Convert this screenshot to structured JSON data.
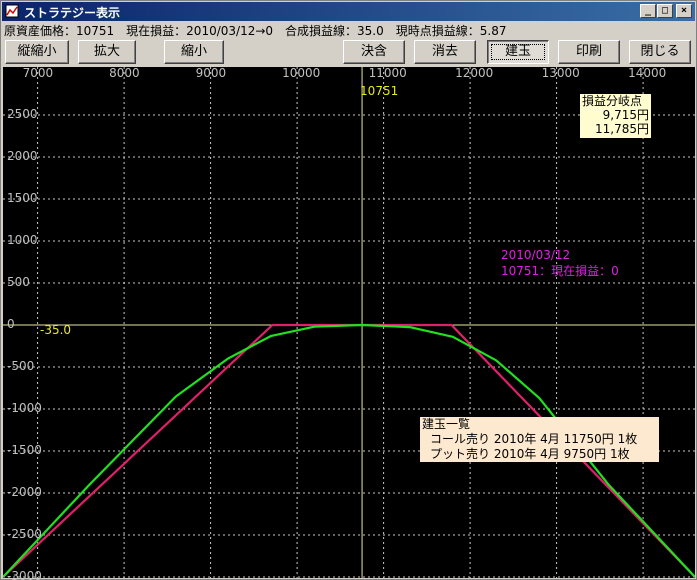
{
  "window": {
    "title": "ストラテジー表示",
    "min_symbol": "_",
    "max_symbol": "□",
    "close_symbol": "×"
  },
  "info_line": "原資産価格：10751　現在損益：2010/03/12→0　合成損益線：35.0　現時点損益線：5.87",
  "toolbar": {
    "zoom_vertical_out": "縦縮小",
    "zoom_in": "拡大",
    "zoom_out": "縮小",
    "settle": "決含",
    "clear": "消去",
    "position": "建玉",
    "print": "印刷",
    "close": "閉じる"
  },
  "chart_data": {
    "type": "line",
    "title": "",
    "xlabel": "",
    "ylabel": "",
    "xlim": [
      6600,
      14600
    ],
    "ylim": [
      -3000,
      3000
    ],
    "x_ticks": [
      "7000",
      "8000",
      "9000",
      "10000",
      "11000",
      "12000",
      "13000",
      "14000"
    ],
    "y_ticks": [
      "2500",
      "2000",
      "1500",
      "1000",
      "500",
      "0",
      "-500",
      "-1000",
      "-1500",
      "-2000",
      "-2500",
      "-3000"
    ],
    "current_price_marker": {
      "x": 10751,
      "label": "10751"
    },
    "zero_line_label": "-35.0",
    "series": [
      {
        "color": "#e0206a",
        "points": [
          [
            6600,
            -3000
          ],
          [
            9715,
            0
          ],
          [
            11785,
            0
          ],
          [
            14600,
            -3000
          ]
        ]
      },
      {
        "color": "#20e020",
        "points": [
          [
            6600,
            -3000
          ],
          [
            7600,
            -1900
          ],
          [
            8600,
            -850
          ],
          [
            9200,
            -400
          ],
          [
            9700,
            -130
          ],
          [
            10200,
            -20
          ],
          [
            10751,
            0
          ],
          [
            11300,
            -25
          ],
          [
            11800,
            -140
          ],
          [
            12300,
            -420
          ],
          [
            12800,
            -870
          ],
          [
            13600,
            -1900
          ],
          [
            14600,
            -3000
          ]
        ]
      }
    ],
    "annotations": {
      "breakeven_title": "損益分岐点",
      "breakeven_low": "9,715円",
      "breakeven_high": "11,785円",
      "current_date": "2010/03/12",
      "current_pl": "10751：現在損益：0",
      "positions_title": "建玉一覧",
      "position_1": "コール売り 2010年 4月 11750円 1枚",
      "position_2": "プット売り 2010年 4月 9750円 1枚"
    }
  }
}
